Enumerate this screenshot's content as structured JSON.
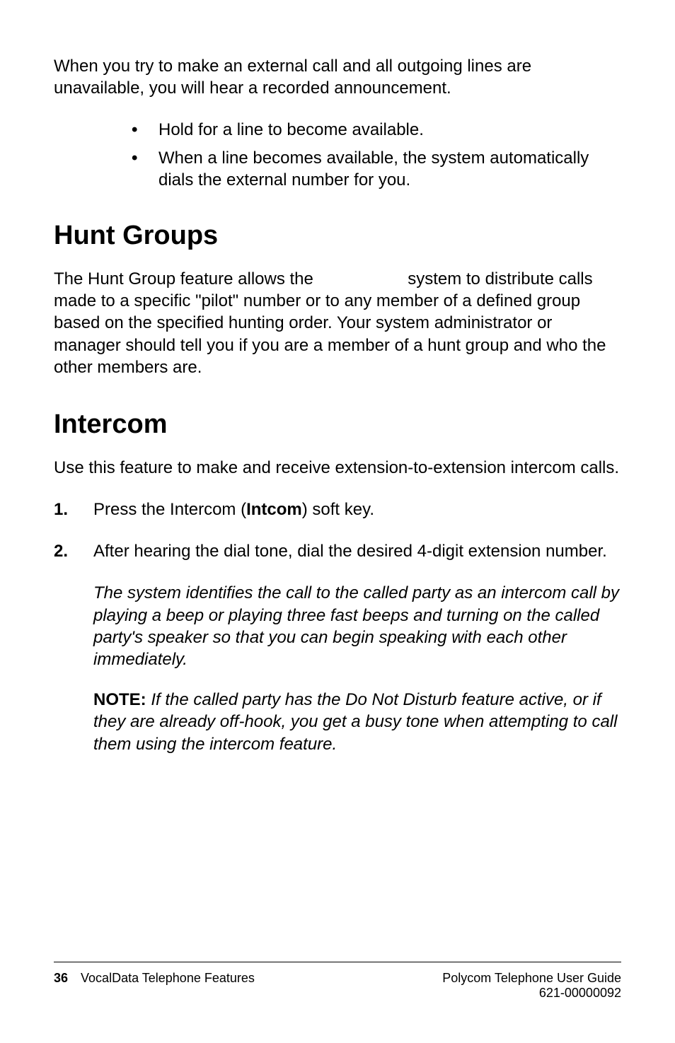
{
  "intro": "When you try to make an external call and all outgoing lines are unavailable, you will hear a recorded announcement.",
  "bullets": [
    "Hold for a line to become available.",
    "When a line becomes available, the system automatically dials the external number for you."
  ],
  "section1": {
    "heading": "Hunt Groups",
    "para_pre": "The Hunt Group feature allows the ",
    "para_post": " system to distribute calls made to a specific \"pilot\" number or to any member of a defined group based on the specified hunting order. Your system administrator or manager should tell you if you are a member of a hunt group and who the other members are."
  },
  "section2": {
    "heading": "Intercom",
    "para": "Use this feature to make and receive extension-to-extension intercom calls.",
    "steps": {
      "step1_pre": "Press the Intercom (",
      "step1_bold": "Intcom",
      "step1_post": ") soft key.",
      "step2": "After hearing the dial tone, dial the desired 4-digit extension number."
    },
    "sub": "The system identifies the call to the called party as an intercom call by playing a beep or playing three fast beeps and turning on the called party's speaker so that you can begin speaking with each other immediately.",
    "note_label": "NOTE:",
    "note_text": " If the called party has the Do Not Disturb feature active, or if they are already off-hook, you get a busy tone when attempting to call them using the intercom feature."
  },
  "footer": {
    "page": "36",
    "left_text": "VocalData Telephone Features",
    "right_line1": "Polycom Telephone User Guide",
    "right_line2": "621-00000092"
  }
}
